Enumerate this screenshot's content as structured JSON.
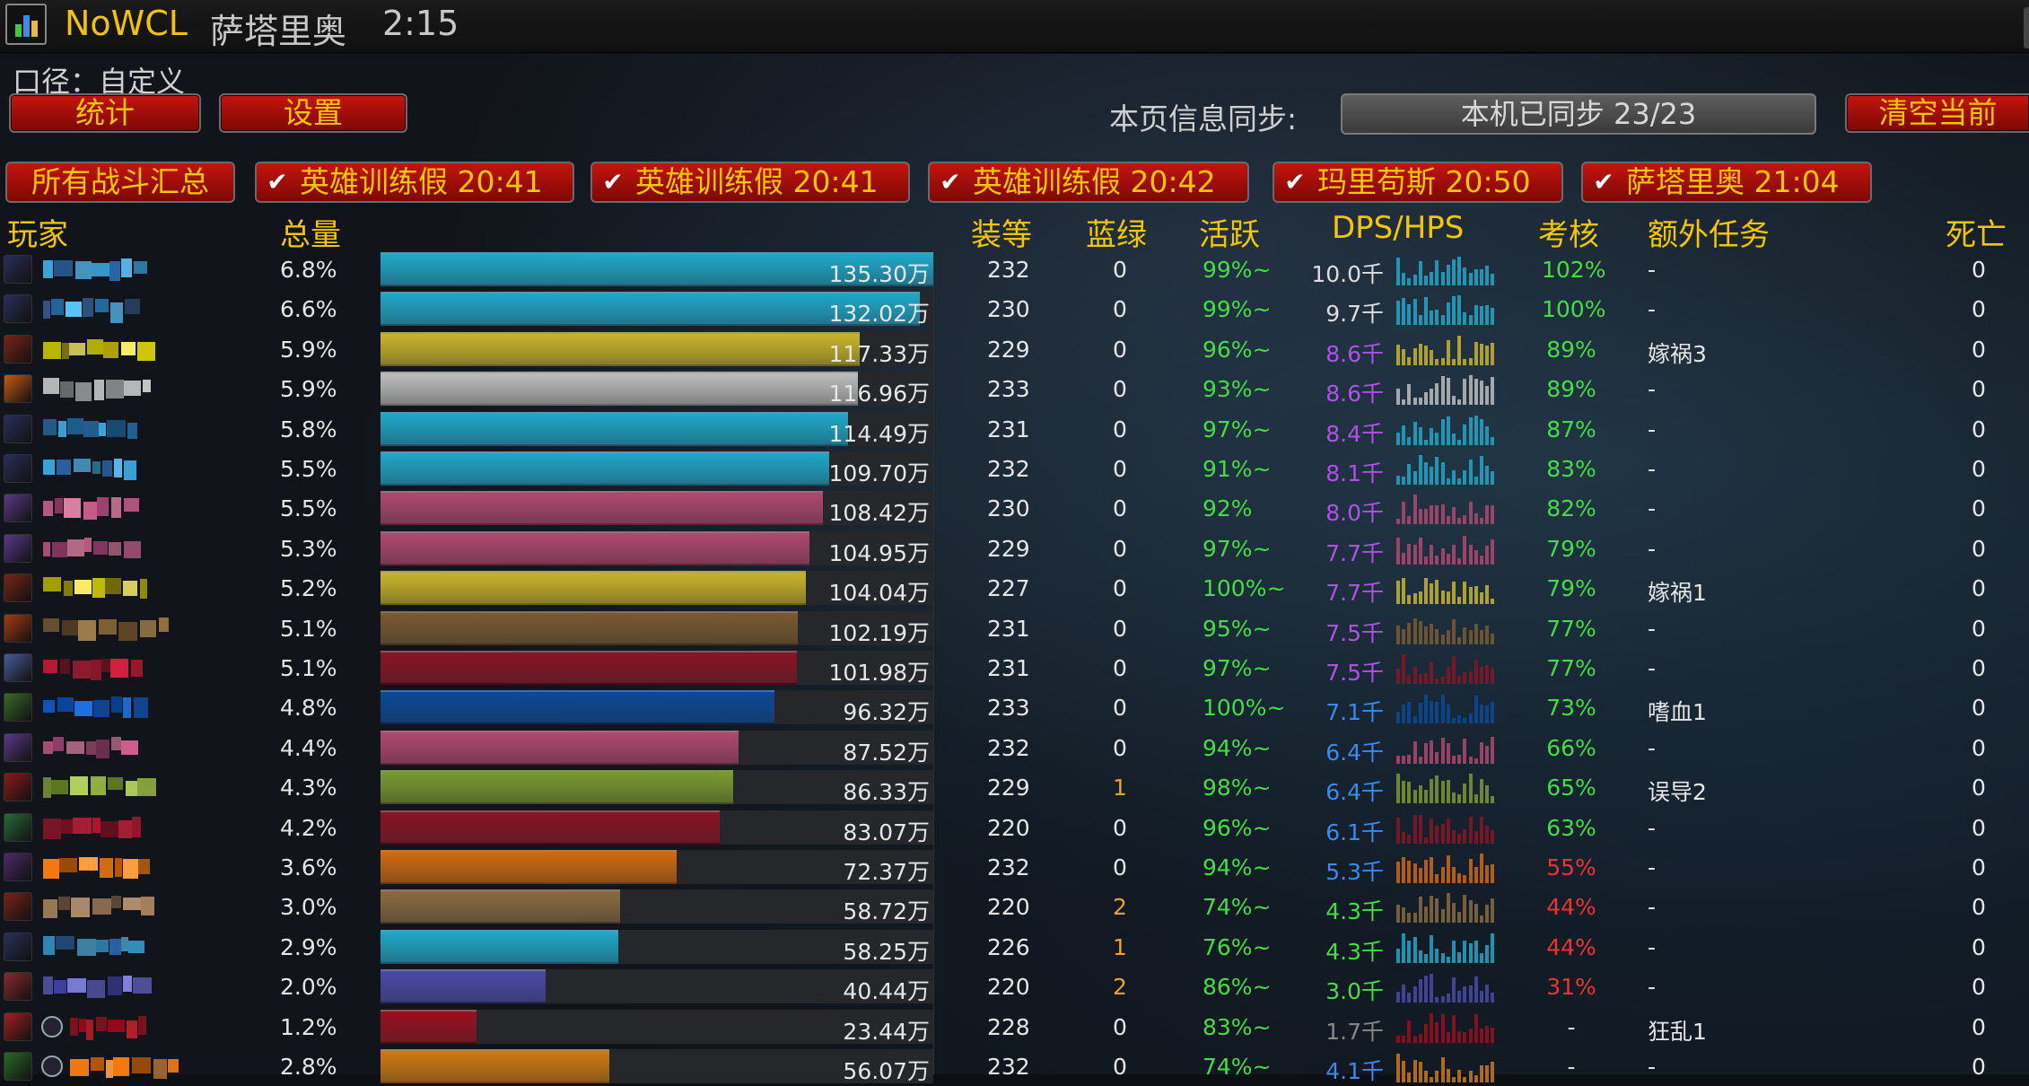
{
  "window": {
    "app_name": "NoWCL",
    "fight_name": "萨塔里奥",
    "fight_time": "2:15"
  },
  "caliber_label": "口径：自定义",
  "buttons": {
    "stats": "统计",
    "settings": "设置",
    "clear": "清空当前"
  },
  "sync": {
    "label": "本页信息同步:",
    "status": "本机已同步 23/23"
  },
  "tabs": [
    {
      "label": "所有战斗汇总",
      "checked": false
    },
    {
      "label": "英雄训练假 20:41",
      "checked": true
    },
    {
      "label": "英雄训练假 20:41",
      "checked": true
    },
    {
      "label": "英雄训练假 20:42",
      "checked": true
    },
    {
      "label": "玛里苟斯 20:50",
      "checked": true
    },
    {
      "label": "萨塔里奥 21:04",
      "checked": true
    }
  ],
  "columns": {
    "player": "玩家",
    "total": "总量",
    "ilvl": "装等",
    "green": "蓝绿",
    "active": "活跃",
    "dps": "DPS/HPS",
    "perf": "考核",
    "extra": "额外任务",
    "death": "死亡"
  },
  "colors": {
    "accent_gold": "#f2c600",
    "button_red": "#b3120c",
    "active_green": "#44dd44",
    "perf_good": "#44dd44",
    "perf_bad": "#ee3333",
    "green_count": "#f0a030"
  },
  "rows": [
    {
      "class_color": "#1fa8c9",
      "icon_color": "#2a2e5a",
      "name_colors": [
        "#3aa9e0",
        "#2b6bb0",
        "#5cc8ff"
      ],
      "pct": "6.8%",
      "share": 1.0,
      "total": "135.30万",
      "ilvl": "232",
      "green": "0",
      "active": "99%~",
      "dps": "10.0千",
      "dps_color": "#dddddd",
      "perf": "102%",
      "perf_color": "#44dd44",
      "extra": "-",
      "death": "0"
    },
    {
      "class_color": "#1fa8c9",
      "icon_color": "#2a2e5a",
      "name_colors": [
        "#3a5c90",
        "#2b8bd0",
        "#5cc8ff"
      ],
      "pct": "6.6%",
      "share": 0.976,
      "total": "132.02万",
      "ilvl": "230",
      "green": "0",
      "active": "99%~",
      "dps": "9.7千",
      "dps_color": "#dddddd",
      "perf": "100%",
      "perf_color": "#44dd44",
      "extra": "-",
      "death": "0"
    },
    {
      "class_color": "#c9b52a",
      "icon_color": "#7a2418",
      "name_colors": [
        "#e8e000",
        "#b8a800",
        "#fff066"
      ],
      "pct": "5.9%",
      "share": 0.867,
      "total": "117.33万",
      "ilvl": "229",
      "green": "0",
      "active": "96%~",
      "dps": "8.6千",
      "dps_color": "#b050e8",
      "perf": "89%",
      "perf_color": "#44dd44",
      "extra": "嫁祸3",
      "death": "0"
    },
    {
      "class_color": "#bdbdbd",
      "icon_color": "#c85a10",
      "name_colors": [
        "#ffffff",
        "#aaaaaa",
        "#dddddd"
      ],
      "pct": "5.9%",
      "share": 0.864,
      "total": "116.96万",
      "ilvl": "233",
      "green": "0",
      "active": "93%~",
      "dps": "8.6千",
      "dps_color": "#b050e8",
      "perf": "89%",
      "perf_color": "#44dd44",
      "extra": "-",
      "death": "0"
    },
    {
      "class_color": "#1fa8c9",
      "icon_color": "#2a2e5a",
      "name_colors": [
        "#2b8bd0",
        "#3aa9e0",
        "#1a6aa0"
      ],
      "pct": "5.8%",
      "share": 0.846,
      "total": "114.49万",
      "ilvl": "231",
      "green": "0",
      "active": "97%~",
      "dps": "8.4千",
      "dps_color": "#b050e8",
      "perf": "87%",
      "perf_color": "#44dd44",
      "extra": "-",
      "death": "0"
    },
    {
      "class_color": "#1fa8c9",
      "icon_color": "#2a2e5a",
      "name_colors": [
        "#3aa9e0",
        "#2b6bb0",
        "#5cc8ff"
      ],
      "pct": "5.5%",
      "share": 0.811,
      "total": "109.70万",
      "ilvl": "232",
      "green": "0",
      "active": "91%~",
      "dps": "8.1千",
      "dps_color": "#b050e8",
      "perf": "83%",
      "perf_color": "#44dd44",
      "extra": "-",
      "death": "0"
    },
    {
      "class_color": "#b0486e",
      "icon_color": "#5a3a8a",
      "name_colors": [
        "#d06090",
        "#a04070",
        "#f08ab0"
      ],
      "pct": "5.5%",
      "share": 0.801,
      "total": "108.42万",
      "ilvl": "230",
      "green": "0",
      "active": "92%",
      "dps": "8.0千",
      "dps_color": "#b050e8",
      "perf": "82%",
      "perf_color": "#44dd44",
      "extra": "-",
      "death": "0"
    },
    {
      "class_color": "#b0486e",
      "icon_color": "#5a3a8a",
      "name_colors": [
        "#d06090",
        "#a04070",
        "#f08ab0"
      ],
      "pct": "5.3%",
      "share": 0.776,
      "total": "104.95万",
      "ilvl": "229",
      "green": "0",
      "active": "97%~",
      "dps": "7.7千",
      "dps_color": "#b050e8",
      "perf": "79%",
      "perf_color": "#44dd44",
      "extra": "-",
      "death": "0"
    },
    {
      "class_color": "#c9b52a",
      "icon_color": "#7a2418",
      "name_colors": [
        "#e8e000",
        "#b8a800",
        "#fff066"
      ],
      "pct": "5.2%",
      "share": 0.769,
      "total": "104.04万",
      "ilvl": "227",
      "green": "0",
      "active": "100%~",
      "dps": "7.7千",
      "dps_color": "#b050e8",
      "perf": "79%",
      "perf_color": "#44dd44",
      "extra": "嫁祸1",
      "death": "0"
    },
    {
      "class_color": "#7a5a30",
      "icon_color": "#a83a10",
      "name_colors": [
        "#a07840",
        "#705028",
        "#c09858"
      ],
      "pct": "5.1%",
      "share": 0.755,
      "total": "102.19万",
      "ilvl": "231",
      "green": "0",
      "active": "95%~",
      "dps": "7.5千",
      "dps_color": "#b050e8",
      "perf": "77%",
      "perf_color": "#44dd44",
      "extra": "-",
      "death": "0"
    },
    {
      "class_color": "#8a1424",
      "icon_color": "#4a5a9a",
      "name_colors": [
        "#c01830",
        "#901020",
        "#e02040"
      ],
      "pct": "5.1%",
      "share": 0.754,
      "total": "101.98万",
      "ilvl": "231",
      "green": "0",
      "active": "97%~",
      "dps": "7.5千",
      "dps_color": "#b050e8",
      "perf": "77%",
      "perf_color": "#44dd44",
      "extra": "-",
      "death": "0"
    },
    {
      "class_color": "#0a4a98",
      "icon_color": "#3a6a2a",
      "name_colors": [
        "#1060d0",
        "#0848a0",
        "#2080ff"
      ],
      "pct": "4.8%",
      "share": 0.712,
      "total": "96.32万",
      "ilvl": "233",
      "green": "0",
      "active": "100%~",
      "dps": "7.1千",
      "dps_color": "#3a8af0",
      "perf": "73%",
      "perf_color": "#44dd44",
      "extra": "嗜血1",
      "death": "0"
    },
    {
      "class_color": "#b0486e",
      "icon_color": "#5a3a8a",
      "name_colors": [
        "#d06090",
        "#a04070",
        "#f08ab0"
      ],
      "pct": "4.4%",
      "share": 0.647,
      "total": "87.52万",
      "ilvl": "232",
      "green": "0",
      "active": "94%~",
      "dps": "6.4千",
      "dps_color": "#3a8af0",
      "perf": "66%",
      "perf_color": "#44dd44",
      "extra": "-",
      "death": "0"
    },
    {
      "class_color": "#7a9a30",
      "icon_color": "#8a1a1a",
      "name_colors": [
        "#9ab840",
        "#6a8a20",
        "#c0e060"
      ],
      "pct": "4.3%",
      "share": 0.638,
      "total": "86.33万",
      "ilvl": "229",
      "green": "1",
      "active": "98%~",
      "dps": "6.4千",
      "dps_color": "#3a8af0",
      "perf": "65%",
      "perf_color": "#44dd44",
      "extra": "误导2",
      "death": "0"
    },
    {
      "class_color": "#8a1424",
      "icon_color": "#2a6a3a",
      "name_colors": [
        "#c01830",
        "#901020",
        "#e02040"
      ],
      "pct": "4.2%",
      "share": 0.614,
      "total": "83.07万",
      "ilvl": "220",
      "green": "0",
      "active": "96%~",
      "dps": "6.1千",
      "dps_color": "#3a8af0",
      "perf": "63%",
      "perf_color": "#44dd44",
      "extra": "-",
      "death": "0"
    },
    {
      "class_color": "#d06a10",
      "icon_color": "#4a2a6a",
      "name_colors": [
        "#ff8010",
        "#d06000",
        "#ffa040"
      ],
      "pct": "3.6%",
      "share": 0.535,
      "total": "72.37万",
      "ilvl": "232",
      "green": "0",
      "active": "94%~",
      "dps": "5.3千",
      "dps_color": "#3a8af0",
      "perf": "55%",
      "perf_color": "#ee3333",
      "extra": "-",
      "death": "0"
    },
    {
      "class_color": "#8a6a40",
      "icon_color": "#7a2418",
      "name_colors": [
        "#b08860",
        "#806040",
        "#d0a880"
      ],
      "pct": "3.0%",
      "share": 0.434,
      "total": "58.72万",
      "ilvl": "220",
      "green": "2",
      "active": "74%~",
      "dps": "4.3千",
      "dps_color": "#44dd44",
      "perf": "44%",
      "perf_color": "#ee3333",
      "extra": "-",
      "death": "0"
    },
    {
      "class_color": "#1fa8c9",
      "icon_color": "#2a2e5a",
      "name_colors": [
        "#3aa9e0",
        "#2b6bb0",
        "#5cc8ff"
      ],
      "pct": "2.9%",
      "share": 0.431,
      "total": "58.25万",
      "ilvl": "226",
      "green": "1",
      "active": "76%~",
      "dps": "4.3千",
      "dps_color": "#44dd44",
      "perf": "44%",
      "perf_color": "#ee3333",
      "extra": "-",
      "death": "0"
    },
    {
      "class_color": "#4a4aa8",
      "icon_color": "#8a2a2a",
      "name_colors": [
        "#6a6ad0",
        "#4040a0",
        "#8a8af0"
      ],
      "pct": "2.0%",
      "share": 0.299,
      "total": "40.44万",
      "ilvl": "220",
      "green": "2",
      "active": "86%~",
      "dps": "3.0千",
      "dps_color": "#44dd44",
      "perf": "31%",
      "perf_color": "#ee3333",
      "extra": "-",
      "death": "0"
    },
    {
      "class_color": "#9a1020",
      "icon_color": "#a02020",
      "name_colors": [
        "#d01020",
        "#a00818",
        "#f02030"
      ],
      "pct": "1.2%",
      "share": 0.173,
      "total": "23.44万",
      "ilvl": "228",
      "green": "0",
      "active": "83%~",
      "dps": "1.7千",
      "dps_color": "#888888",
      "perf": "-",
      "perf_color": "#dddddd",
      "extra": "狂乱1",
      "death": "0",
      "second_icon": true
    },
    {
      "class_color": "#d07a10",
      "icon_color": "#2a6a2a",
      "name_colors": [
        "#ff8010",
        "#d06000",
        "#ffa040"
      ],
      "pct": "2.8%",
      "share": 0.414,
      "total": "56.07万",
      "ilvl": "232",
      "green": "0",
      "active": "74%~",
      "dps": "4.1千",
      "dps_color": "#3a8af0",
      "perf": "-",
      "perf_color": "#dddddd",
      "extra": "-",
      "death": "0",
      "second_icon": true
    }
  ]
}
